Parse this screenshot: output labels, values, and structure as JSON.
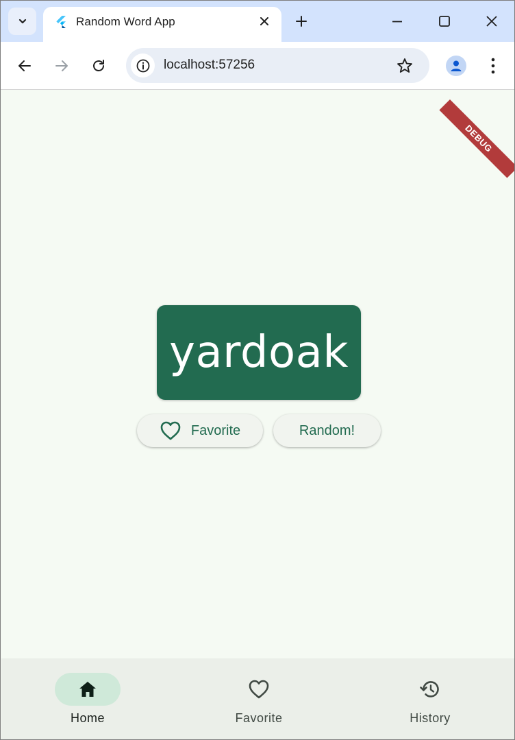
{
  "browser": {
    "tab_title": "Random Word App",
    "url": "localhost:57256",
    "icons": {
      "tab_search": "chevron-down-icon",
      "tab_favicon": "flutter-icon",
      "tab_close": "close-icon",
      "new_tab": "plus-icon",
      "minimize": "minimize-icon",
      "maximize": "maximize-icon",
      "close_window": "close-icon",
      "back": "arrow-left-icon",
      "forward": "arrow-right-icon",
      "reload": "reload-icon",
      "site_info": "info-icon",
      "bookmark": "star-icon",
      "profile": "person-icon",
      "menu": "more-vert-icon"
    }
  },
  "app": {
    "debug_banner": "DEBUG",
    "current_word": "yardoak",
    "favorite_button_label": "Favorite",
    "random_button_label": "Random!",
    "nav": [
      {
        "label": "Home",
        "icon": "home-icon",
        "active": true
      },
      {
        "label": "Favorite",
        "icon": "heart-outline-icon",
        "active": false
      },
      {
        "label": "History",
        "icon": "history-icon",
        "active": false
      }
    ]
  },
  "colors": {
    "accent": "#226b50",
    "background": "#f5faf3",
    "nav_background": "#ebefe9",
    "active_pill": "#cfe9d9",
    "debug_banner": "#b23b3b",
    "browser_chrome": "#d3e3fd"
  }
}
